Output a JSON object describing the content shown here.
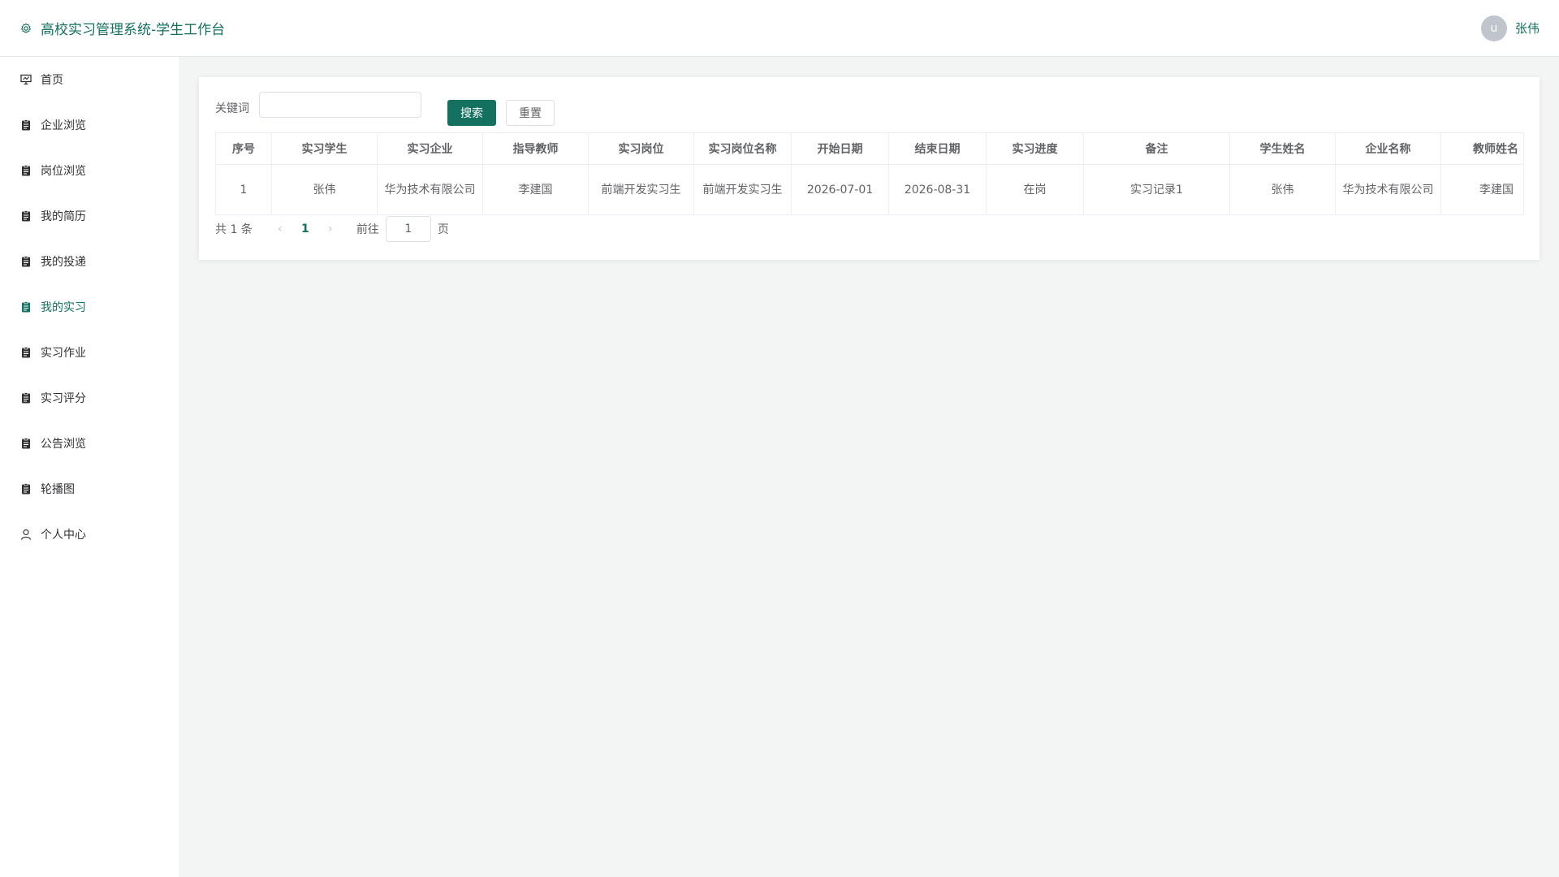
{
  "header": {
    "title": "高校实习管理系统-学生工作台",
    "avatar_letter": "u",
    "user_name": "张伟"
  },
  "sidebar": {
    "items": [
      {
        "label": "首页",
        "icon": "chart-board-icon"
      },
      {
        "label": "企业浏览",
        "icon": "clipboard-icon"
      },
      {
        "label": "岗位浏览",
        "icon": "clipboard-icon"
      },
      {
        "label": "我的简历",
        "icon": "clipboard-icon"
      },
      {
        "label": "我的投递",
        "icon": "clipboard-icon"
      },
      {
        "label": "我的实习",
        "icon": "clipboard-icon",
        "active": true
      },
      {
        "label": "实习作业",
        "icon": "clipboard-icon"
      },
      {
        "label": "实习评分",
        "icon": "clipboard-icon"
      },
      {
        "label": "公告浏览",
        "icon": "clipboard-icon"
      },
      {
        "label": "轮播图",
        "icon": "clipboard-icon"
      },
      {
        "label": "个人中心",
        "icon": "user-icon"
      }
    ]
  },
  "search": {
    "label": "关键词",
    "value": "",
    "search_label": "搜索",
    "reset_label": "重置"
  },
  "table": {
    "headers": [
      "序号",
      "实习学生",
      "实习企业",
      "指导教师",
      "实习岗位",
      "实习岗位名称",
      "开始日期",
      "结束日期",
      "实习进度",
      "备注",
      "学生姓名",
      "企业名称",
      "教师姓名"
    ],
    "rows": [
      [
        "1",
        "张伟",
        "华为技术有限公司",
        "李建国",
        "前端开发实习生",
        "前端开发实习生",
        "2026-07-01",
        "2026-08-31",
        "在岗",
        "实习记录1",
        "张伟",
        "华为技术有限公司",
        "李建国"
      ]
    ]
  },
  "pagination": {
    "total": "共 1 条",
    "prev": "‹",
    "current": "1",
    "next": "›",
    "goto_label": "前往",
    "goto_value": "1",
    "page_suffix": "页"
  },
  "colors": {
    "accent": "#14705f",
    "background": "#f3f4f4"
  }
}
